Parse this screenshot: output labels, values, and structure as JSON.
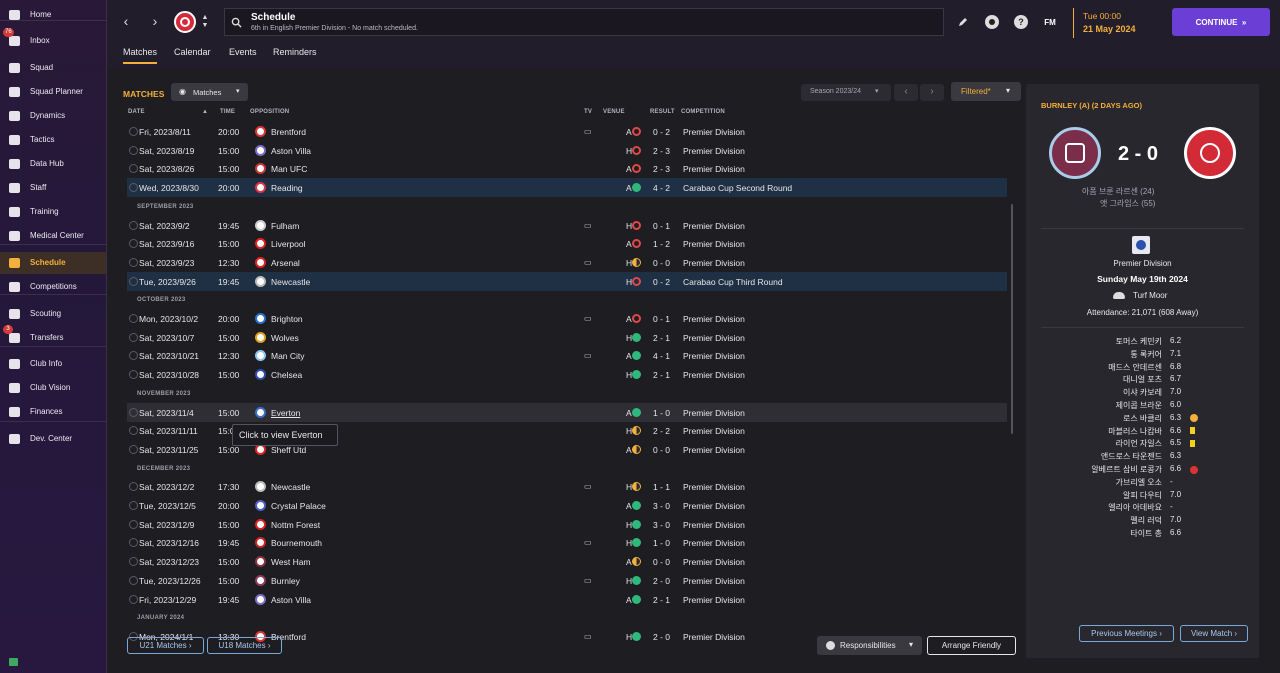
{
  "sidebar": {
    "items": [
      {
        "label": "Home",
        "icon": "home-icon",
        "badge": ""
      },
      {
        "label": "Inbox",
        "icon": "inbox-icon",
        "badge": "76"
      },
      {
        "label": "Squad",
        "icon": "shirt-icon",
        "badge": ""
      },
      {
        "label": "Squad Planner",
        "icon": "planner-icon",
        "badge": ""
      },
      {
        "label": "Dynamics",
        "icon": "dynamics-icon",
        "badge": ""
      },
      {
        "label": "Tactics",
        "icon": "tactics-icon",
        "badge": ""
      },
      {
        "label": "Data Hub",
        "icon": "data-hub-icon",
        "badge": ""
      },
      {
        "label": "Staff",
        "icon": "staff-icon",
        "badge": ""
      },
      {
        "label": "Training",
        "icon": "training-icon",
        "badge": ""
      },
      {
        "label": "Medical Center",
        "icon": "medical-icon",
        "badge": ""
      },
      {
        "label": "Schedule",
        "icon": "calendar-icon",
        "badge": ""
      },
      {
        "label": "Competitions",
        "icon": "trophy-icon",
        "badge": ""
      },
      {
        "label": "Scouting",
        "icon": "scouting-icon",
        "badge": ""
      },
      {
        "label": "Transfers",
        "icon": "transfers-icon",
        "badge": "3"
      },
      {
        "label": "Club Info",
        "icon": "club-info-icon",
        "badge": ""
      },
      {
        "label": "Club Vision",
        "icon": "club-vision-icon",
        "badge": ""
      },
      {
        "label": "Finances",
        "icon": "finances-icon",
        "badge": ""
      },
      {
        "label": "Dev. Center",
        "icon": "dev-center-icon",
        "badge": ""
      }
    ]
  },
  "header": {
    "title": "Schedule",
    "subtitle": "6th in English Premier Division - No match scheduled.",
    "time": "Tue 00:00",
    "date": "21 May 2024",
    "continue_label": "CONTINUE",
    "fm_label": "FM"
  },
  "tabs": [
    "Matches",
    "Calendar",
    "Events",
    "Reminders"
  ],
  "matches_panel": {
    "title": "MATCHES",
    "dropdown": "Matches",
    "season": "Season 2023/24",
    "filter": "Filtered*",
    "columns": {
      "date": "DATE",
      "time": "TIME",
      "opposition": "OPPOSITION",
      "tv": "TV",
      "venue": "VENUE",
      "result": "RESULT",
      "competition": "COMPETITION"
    },
    "tooltip": "Click to view Everton",
    "u21": "U21 Matches",
    "u18": "U18 Matches",
    "responsibilities": "Responsibilities",
    "arrange": "Arrange Friendly"
  },
  "rows": [
    {
      "type": "match",
      "date": "Fri, 2023/8/11",
      "time": "20:00",
      "opp": "Brentford",
      "tv": true,
      "venue": "A",
      "res": "l",
      "score": "0 - 2",
      "comp": "Premier Division",
      "crest": "#d33"
    },
    {
      "type": "match",
      "date": "Sat, 2023/8/19",
      "time": "15:00",
      "opp": "Aston Villa",
      "tv": false,
      "venue": "H",
      "res": "l",
      "score": "2 - 3",
      "comp": "Premier Division",
      "crest": "#7a6bc0"
    },
    {
      "type": "match",
      "date": "Sat, 2023/8/26",
      "time": "15:00",
      "opp": "Man UFC",
      "tv": false,
      "venue": "A",
      "res": "l",
      "score": "2 - 3",
      "comp": "Premier Division",
      "crest": "#c33"
    },
    {
      "type": "match",
      "date": "Wed, 2023/8/30",
      "time": "20:00",
      "opp": "Reading",
      "tv": false,
      "venue": "A",
      "res": "w",
      "score": "4 - 2",
      "comp": "Carabao Cup Second Round",
      "crest": "#d34",
      "hl": true
    },
    {
      "type": "month",
      "label": "SEPTEMBER 2023"
    },
    {
      "type": "match",
      "date": "Sat, 2023/9/2",
      "time": "19:45",
      "opp": "Fulham",
      "tv": true,
      "venue": "H",
      "res": "l",
      "score": "0 - 1",
      "comp": "Premier Division",
      "crest": "#ccc"
    },
    {
      "type": "match",
      "date": "Sat, 2023/9/16",
      "time": "15:00",
      "opp": "Liverpool",
      "tv": false,
      "venue": "A",
      "res": "l",
      "score": "1 - 2",
      "comp": "Premier Division",
      "crest": "#d22"
    },
    {
      "type": "match",
      "date": "Sat, 2023/9/23",
      "time": "12:30",
      "opp": "Arsenal",
      "tv": true,
      "venue": "H",
      "res": "d",
      "score": "0 - 0",
      "comp": "Premier Division",
      "crest": "#d22"
    },
    {
      "type": "match",
      "date": "Tue, 2023/9/26",
      "time": "19:45",
      "opp": "Newcastle",
      "tv": false,
      "venue": "H",
      "res": "l",
      "score": "0 - 2",
      "comp": "Carabao Cup Third Round",
      "crest": "#bbb",
      "hl": true
    },
    {
      "type": "month",
      "label": "OCTOBER 2023"
    },
    {
      "type": "match",
      "date": "Mon, 2023/10/2",
      "time": "20:00",
      "opp": "Brighton",
      "tv": true,
      "venue": "A",
      "res": "l",
      "score": "0 - 1",
      "comp": "Premier Division",
      "crest": "#2b6fd0"
    },
    {
      "type": "match",
      "date": "Sat, 2023/10/7",
      "time": "15:00",
      "opp": "Wolves",
      "tv": false,
      "venue": "H",
      "res": "w",
      "score": "2 - 1",
      "comp": "Premier Division",
      "crest": "#e0a020"
    },
    {
      "type": "match",
      "date": "Sat, 2023/10/21",
      "time": "12:30",
      "opp": "Man City",
      "tv": true,
      "venue": "A",
      "res": "w",
      "score": "4 - 1",
      "comp": "Premier Division",
      "crest": "#8cc4ee"
    },
    {
      "type": "match",
      "date": "Sat, 2023/10/28",
      "time": "15:00",
      "opp": "Chelsea",
      "tv": false,
      "venue": "H",
      "res": "w",
      "score": "2 - 1",
      "comp": "Premier Division",
      "crest": "#2a4fb0"
    },
    {
      "type": "month",
      "label": "NOVEMBER 2023"
    },
    {
      "type": "match",
      "date": "Sat, 2023/11/4",
      "time": "15:00",
      "opp": "Everton",
      "tv": false,
      "venue": "A",
      "res": "w",
      "score": "1 - 0",
      "comp": "Premier Division",
      "crest": "#3a6fc8",
      "hover": true,
      "underline": true
    },
    {
      "type": "match",
      "date": "Sat, 2023/11/11",
      "time": "15:00",
      "opp": "",
      "tv": false,
      "venue": "H",
      "res": "d",
      "score": "2 - 2",
      "comp": "Premier Division",
      "crest": "#888"
    },
    {
      "type": "match",
      "date": "Sat, 2023/11/25",
      "time": "15:00",
      "opp": "Sheff Utd",
      "tv": false,
      "venue": "A",
      "res": "d",
      "score": "0 - 0",
      "comp": "Premier Division",
      "crest": "#d22"
    },
    {
      "type": "month",
      "label": "DECEMBER 2023"
    },
    {
      "type": "match",
      "date": "Sat, 2023/12/2",
      "time": "17:30",
      "opp": "Newcastle",
      "tv": true,
      "venue": "H",
      "res": "d",
      "score": "1 - 1",
      "comp": "Premier Division",
      "crest": "#bbb"
    },
    {
      "type": "match",
      "date": "Tue, 2023/12/5",
      "time": "20:00",
      "opp": "Crystal Palace",
      "tv": false,
      "venue": "A",
      "res": "w",
      "score": "3 - 0",
      "comp": "Premier Division",
      "crest": "#4a5fc8"
    },
    {
      "type": "match",
      "date": "Sat, 2023/12/9",
      "time": "15:00",
      "opp": "Nottm Forest",
      "tv": false,
      "venue": "H",
      "res": "w",
      "score": "3 - 0",
      "comp": "Premier Division",
      "crest": "#d22"
    },
    {
      "type": "match",
      "date": "Sat, 2023/12/16",
      "time": "19:45",
      "opp": "Bournemouth",
      "tv": true,
      "venue": "H",
      "res": "w",
      "score": "1 - 0",
      "comp": "Premier Division",
      "crest": "#c22"
    },
    {
      "type": "match",
      "date": "Sat, 2023/12/23",
      "time": "15:00",
      "opp": "West Ham",
      "tv": false,
      "venue": "A",
      "res": "d",
      "score": "0 - 0",
      "comp": "Premier Division",
      "crest": "#8a3040"
    },
    {
      "type": "match",
      "date": "Tue, 2023/12/26",
      "time": "15:00",
      "opp": "Burnley",
      "tv": true,
      "venue": "H",
      "res": "w",
      "score": "2 - 0",
      "comp": "Premier Division",
      "crest": "#8a3a5a"
    },
    {
      "type": "match",
      "date": "Fri, 2023/12/29",
      "time": "19:45",
      "opp": "Aston Villa",
      "tv": false,
      "venue": "A",
      "res": "w",
      "score": "2 - 1",
      "comp": "Premier Division",
      "crest": "#7a6bc0"
    },
    {
      "type": "month",
      "label": "JANUARY 2024"
    },
    {
      "type": "match",
      "date": "Mon, 2024/1/1",
      "time": "13:30",
      "opp": "Brentford",
      "tv": true,
      "venue": "H",
      "res": "w",
      "score": "2 - 0",
      "comp": "Premier Division",
      "crest": "#d33"
    }
  ],
  "detail": {
    "heading": "BURNLEY (A) (2 DAYS AGO)",
    "score": "2 - 0",
    "scorers": [
      "아폼 브룬 라르센 (24)",
      "앳 그라임스 (55)"
    ],
    "competition": "Premier Division",
    "date": "Sunday May 19th 2024",
    "stadium": "Turf Moor",
    "attendance": "Attendance: 21,071 (608 Away)",
    "ratings": [
      {
        "name": "토머스 케민키",
        "r": "6.2",
        "mark": ""
      },
      {
        "name": "통 록커어",
        "r": "7.1",
        "mark": ""
      },
      {
        "name": "매드스 안데르센",
        "r": "6.8",
        "mark": ""
      },
      {
        "name": "대니얼 포츠",
        "r": "6.7",
        "mark": ""
      },
      {
        "name": "이샤 카보레",
        "r": "7.0",
        "mark": ""
      },
      {
        "name": "제이콥 브라운",
        "r": "6.0",
        "mark": ""
      },
      {
        "name": "로스 바클리",
        "r": "6.3",
        "mark": "sub"
      },
      {
        "name": "마블러스 나캄바",
        "r": "6.6",
        "mark": "yellow"
      },
      {
        "name": "라이언 자일스",
        "r": "6.5",
        "mark": "yellow"
      },
      {
        "name": "앤드로스 타운젠드",
        "r": "6.3",
        "mark": ""
      },
      {
        "name": "알베르트 삼비 로콩가",
        "r": "6.6",
        "mark": "red"
      },
      {
        "name": "가브리엘 오소",
        "r": "-",
        "mark": ""
      },
      {
        "name": "알피 다우티",
        "r": "7.0",
        "mark": ""
      },
      {
        "name": "엘리아 아데바요",
        "r": "-",
        "mark": ""
      },
      {
        "name": "펠리 러덕",
        "r": "7.0",
        "mark": ""
      },
      {
        "name": "타이트 총",
        "r": "6.6",
        "mark": ""
      }
    ],
    "prev_label": "Previous Meetings",
    "view_label": "View Match"
  }
}
